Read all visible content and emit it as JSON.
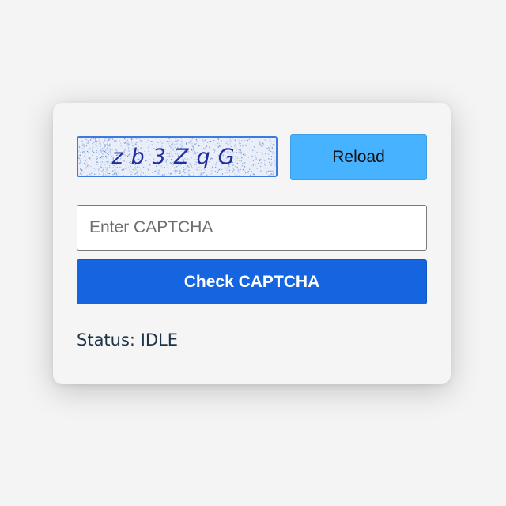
{
  "captcha": {
    "text": "zb3ZqG"
  },
  "reload_button": {
    "label": "Reload"
  },
  "input": {
    "value": "",
    "placeholder": "Enter CAPTCHA"
  },
  "check_button": {
    "label": "Check CAPTCHA"
  },
  "status": {
    "label": "Status:",
    "value": "IDLE"
  },
  "colors": {
    "reload_bg": "#47b2ff",
    "check_bg": "#1565e0",
    "captcha_text": "#232d9e",
    "status_text": "#1f3347"
  }
}
